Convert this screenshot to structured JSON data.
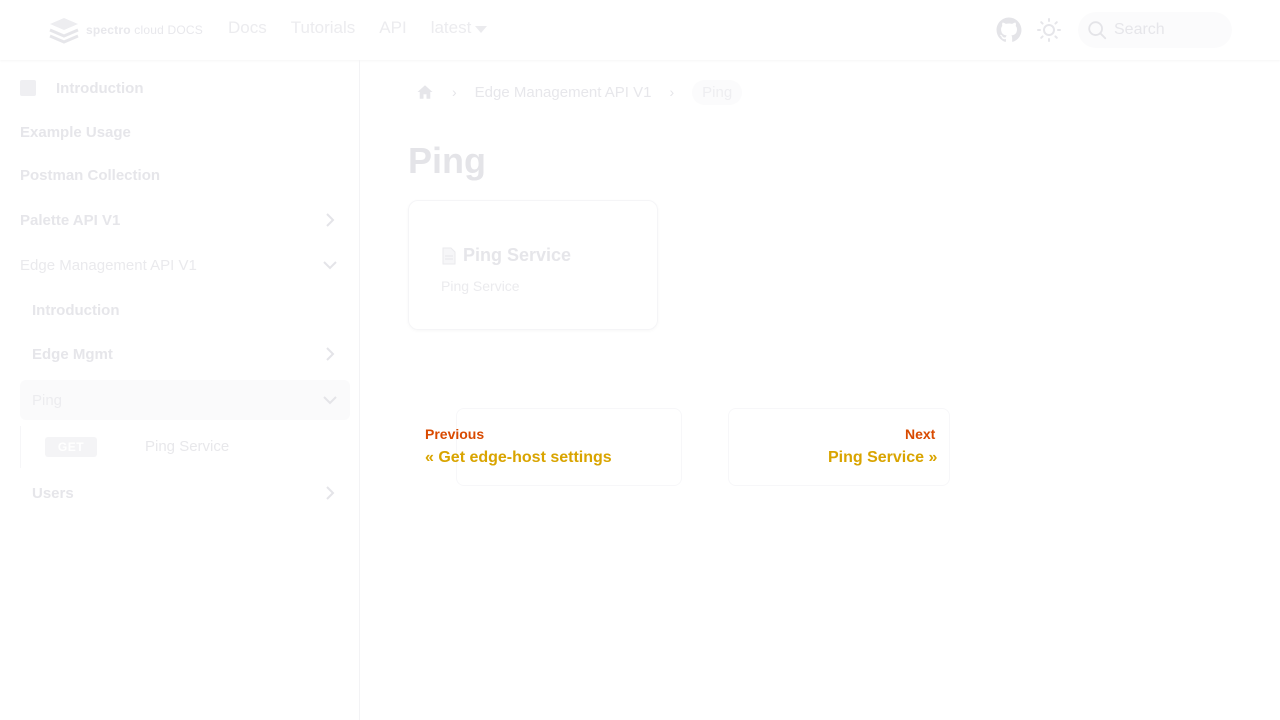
{
  "navbar": {
    "logo_text_bold": "spectro",
    "logo_text_light": "cloud",
    "logo_suffix": "DOCS",
    "links": [
      "Docs",
      "Tutorials",
      "API"
    ],
    "version": "latest",
    "search_placeholder": "Search",
    "icons": [
      "github-icon",
      "sun-icon",
      "search-icon"
    ]
  },
  "sidebar": {
    "items": [
      {
        "label": "Introduction"
      },
      {
        "label": "Example Usage"
      },
      {
        "label": "Postman Collection"
      },
      {
        "label": "Palette API V1"
      },
      {
        "label": "Edge Management API V1"
      },
      {
        "label": "Introduction"
      },
      {
        "label": "Edge Mgmt"
      },
      {
        "label": "Ping"
      },
      {
        "label": "Users"
      }
    ],
    "method_badge": "GET",
    "endpoint_label": "Ping Service"
  },
  "breadcrumb": {
    "parent": "Edge Management API V1",
    "current": "Ping"
  },
  "page": {
    "title": "Ping",
    "card_title": "Ping Service",
    "card_description": "Ping Service"
  },
  "pagination": {
    "prev_label": "Previous",
    "prev_title": "« Get edge-host settings",
    "next_label": "Next",
    "next_title": "Ping Service »"
  },
  "colors": {
    "prev_next_label": "#d94a00",
    "prev_next_title": "#d9a400"
  }
}
